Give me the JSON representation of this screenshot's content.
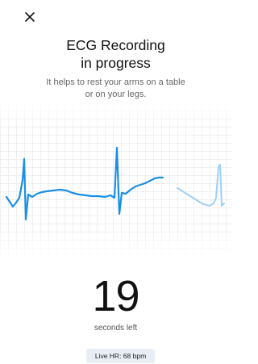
{
  "header": {
    "close_icon": "close-icon"
  },
  "title": {
    "line1": "ECG Recording",
    "line2": "in progress"
  },
  "instructions": {
    "line1": "It helps to rest your arms on a table",
    "line2": "or on your legs."
  },
  "ecg": {
    "trace_color": "#1a8fe6",
    "faded_trace_color": "#9fd0f5",
    "grid_color": "#efefef"
  },
  "timer": {
    "value": "19",
    "label": "seconds left"
  },
  "live_hr": {
    "label": "Live HR: 68 bpm",
    "badge_color": "#e9eef5"
  }
}
